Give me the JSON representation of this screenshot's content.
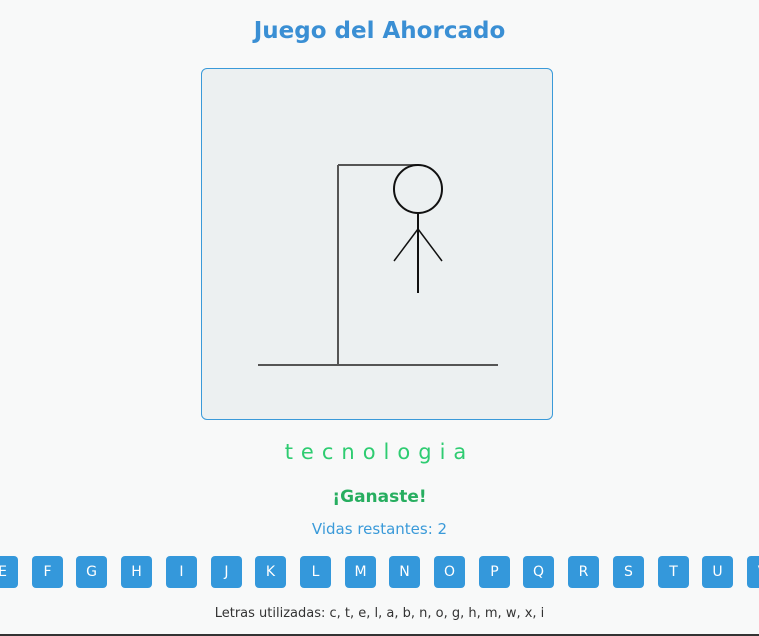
{
  "title": "Juego del Ahorcado",
  "word": "tecnologia",
  "status": "¡Ganaste!",
  "lives_text": "Vidas restantes: 2",
  "keyboard": {
    "keys": [
      "E",
      "F",
      "G",
      "H",
      "I",
      "J",
      "K",
      "L",
      "M",
      "N",
      "O",
      "P",
      "Q",
      "R",
      "S",
      "T",
      "U",
      "V"
    ]
  },
  "used_letters_text": "Letras utilizadas: c, t, e, l, a, b, n, o, g, h, m, w, x, i",
  "colors": {
    "title": "#3a8fd4",
    "word": "#2ecc71",
    "status": "#27ae60",
    "key_bg": "#3498db",
    "canvas_bg": "#ecf0f1",
    "canvas_border": "#3a9ad9"
  }
}
